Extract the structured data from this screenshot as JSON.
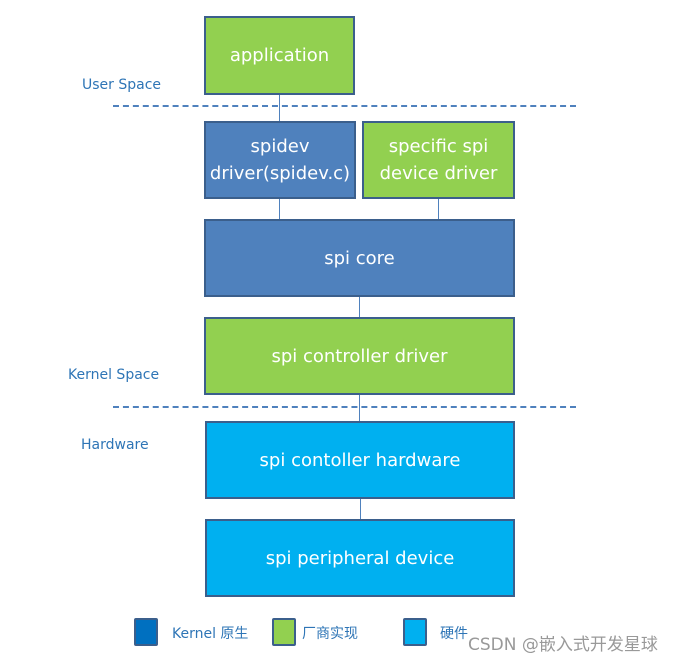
{
  "layers": {
    "user_space": "User Space",
    "kernel_space": "Kernel Space",
    "hardware": "Hardware"
  },
  "boxes": {
    "application": "application",
    "spidev_line1": "spidev",
    "spidev_line2": "driver(spidev.c)",
    "specific_line1": "specific spi",
    "specific_line2": "device driver",
    "spi_core": "spi core",
    "controller_driver": "spi controller driver",
    "controller_hardware": "spi contoller hardware",
    "peripheral": "spi peripheral device"
  },
  "legend": [
    {
      "label": "Kernel 原生",
      "color": "#0070c0"
    },
    {
      "label": "厂商实现",
      "color": "#92d050"
    },
    {
      "label": "硬件",
      "color": "#00b0f0"
    }
  ],
  "watermark": "CSDN @嵌入式开发星球",
  "colors": {
    "kernel": "#4f81bd",
    "vendor": "#92d050",
    "hardware": "#00b0f0",
    "border": "#3b5f8c"
  }
}
